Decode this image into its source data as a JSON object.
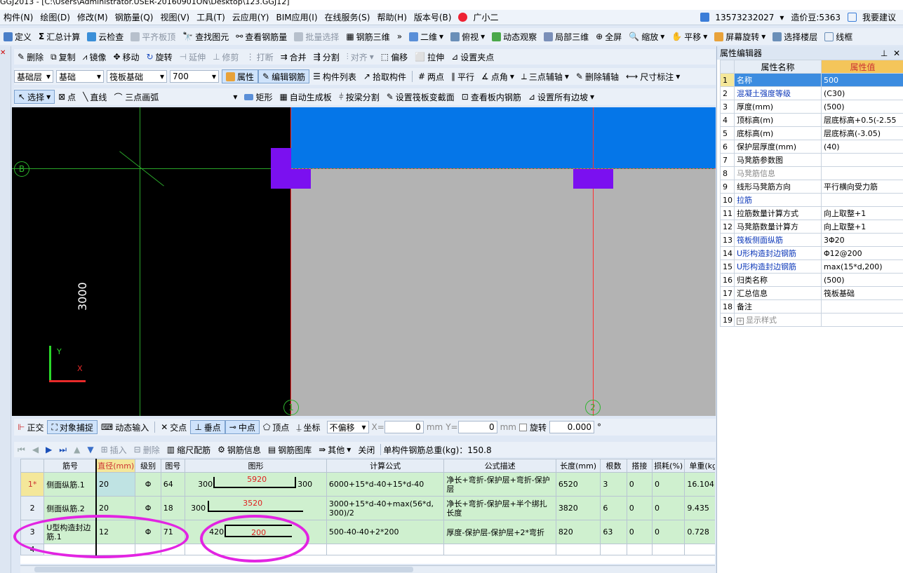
{
  "title_bar": {
    "title": "GGJ2013 - [C:\\Users\\Administrator.USER-20160901ON\\Desktop\\123.GGJ12]"
  },
  "menu": {
    "items": [
      "构件(N)",
      "绘图(D)",
      "修改(M)",
      "钢筋量(Q)",
      "视图(V)",
      "工具(T)",
      "云应用(Y)",
      "BIM应用(I)",
      "在线服务(S)",
      "帮助(H)",
      "版本号(B)"
    ],
    "assistant": "广小二",
    "phone": "13573232027",
    "beans": "造价豆:5363",
    "suggest": "我要建议"
  },
  "toolbar1": {
    "items": [
      "定义",
      "汇总计算",
      "云检查",
      "平齐板顶",
      "查找图元",
      "查看钢筋量",
      "批量选择",
      "钢筋三维",
      "二维",
      "俯视",
      "动态观察",
      "局部三维",
      "全屏",
      "缩放",
      "平移",
      "屏幕旋转",
      "选择楼层",
      "线框"
    ]
  },
  "toolbar2": {
    "items": [
      "删除",
      "复制",
      "镜像",
      "移动",
      "旋转",
      "延伸",
      "修剪",
      "打断",
      "合并",
      "分割",
      "对齐",
      "偏移",
      "拉伸",
      "设置夹点"
    ]
  },
  "toolbar3": {
    "floor": "基础层",
    "category": "基础",
    "type": "筏板基础",
    "value": "700",
    "items": [
      "属性",
      "编辑钢筋",
      "构件列表",
      "拾取构件",
      "两点",
      "平行",
      "点角",
      "三点辅轴",
      "删除辅轴",
      "尺寸标注"
    ]
  },
  "toolbar4": {
    "items": [
      "选择",
      "点",
      "直线",
      "三点画弧",
      "矩形",
      "自动生成板",
      "按梁分割",
      "设置筏板变截面",
      "查看板内钢筋",
      "设置所有边坡"
    ]
  },
  "canvas": {
    "dimension": "3000",
    "axis_b": "B",
    "axis_1": "1",
    "axis_2": "2",
    "y_label": "Y",
    "x_label": "X"
  },
  "statusbar": {
    "items": [
      "正交",
      "对象捕捉",
      "动态输入",
      "交点",
      "垂点",
      "中点",
      "顶点",
      "坐标"
    ],
    "offset": "不偏移",
    "x_label": "X=",
    "x_value": "0",
    "y_label": "Y=",
    "y_value": "0",
    "unit": "mm",
    "rotate": "旋转",
    "rotate_value": "0.000",
    "deg": "°"
  },
  "rebar_toolbar": {
    "items": [
      "插入",
      "删除",
      "缩尺配筋",
      "钢筋信息",
      "钢筋图库",
      "其他",
      "关闭"
    ],
    "total": "单构件钢筋总重(kg)：150.8"
  },
  "rebar_table": {
    "headers": [
      "筋号",
      "直径(mm)",
      "级别",
      "图号",
      "图形",
      "计算公式",
      "公式描述",
      "长度(mm)",
      "根数",
      "搭接",
      "损耗(%)",
      "单重(kg"
    ],
    "rows": [
      {
        "num": "1*",
        "name": "侧面纵筋.1",
        "dia": "20",
        "grade": "Φ",
        "fig": "64",
        "shape_left": "300",
        "shape_mid": "5920",
        "shape_right": "300",
        "formula": "6000+15*d-40+15*d-40",
        "desc": "净长+弯折-保护层+弯折-保护层",
        "len": "6520",
        "count": "3",
        "lap": "0",
        "loss": "0",
        "weight": "16.104"
      },
      {
        "num": "2",
        "name": "侧面纵筋.2",
        "dia": "20",
        "grade": "Φ",
        "fig": "18",
        "shape_left": "300",
        "shape_mid": "3520",
        "shape_right": "",
        "formula": "3000+15*d-40+max(56*d, 300)/2",
        "desc": "净长+弯折-保护层+半个绑扎长度",
        "len": "3820",
        "count": "6",
        "lap": "0",
        "loss": "0",
        "weight": "9.435"
      },
      {
        "num": "3",
        "name": "U型构造封边筋.1",
        "dia": "12",
        "grade": "Φ",
        "fig": "71",
        "shape_left": "420",
        "shape_mid": "200",
        "shape_right": "",
        "formula": "500-40-40+2*200",
        "desc": "厚度-保护层-保护层+2*弯折",
        "len": "820",
        "count": "63",
        "lap": "0",
        "loss": "0",
        "weight": "0.728"
      },
      {
        "num": "4",
        "name": "",
        "dia": "",
        "grade": "",
        "fig": "",
        "shape_left": "",
        "shape_mid": "",
        "shape_right": "",
        "formula": "",
        "desc": "",
        "len": "",
        "count": "",
        "lap": "",
        "loss": "",
        "weight": ""
      }
    ]
  },
  "props": {
    "panel_title": "属性编辑器",
    "col_name": "属性名称",
    "col_value": "属性值",
    "rows": [
      {
        "n": "1",
        "name": "名称",
        "value": "500",
        "blue": true
      },
      {
        "n": "2",
        "name": "混凝土强度等级",
        "value": "(C30)",
        "blue": true
      },
      {
        "n": "3",
        "name": "厚度(mm)",
        "value": "(500)",
        "blue": false
      },
      {
        "n": "4",
        "name": "顶标高(m)",
        "value": "层底标高+0.5(-2.55",
        "blue": false
      },
      {
        "n": "5",
        "name": "底标高(m)",
        "value": "层底标高(-3.05)",
        "blue": false
      },
      {
        "n": "6",
        "name": "保护层厚度(mm)",
        "value": "(40)",
        "blue": false
      },
      {
        "n": "7",
        "name": "马凳筋参数图",
        "value": "",
        "blue": false
      },
      {
        "n": "8",
        "name": "马凳筋信息",
        "value": "",
        "blue": false
      },
      {
        "n": "9",
        "name": "线形马凳筋方向",
        "value": "平行横向受力筋",
        "blue": false
      },
      {
        "n": "10",
        "name": "拉筋",
        "value": "",
        "blue": true
      },
      {
        "n": "11",
        "name": "拉筋数量计算方式",
        "value": "向上取整+1",
        "blue": false
      },
      {
        "n": "12",
        "name": "马凳筋数量计算方",
        "value": "向上取整+1",
        "blue": false
      },
      {
        "n": "13",
        "name": "筏板侧面纵筋",
        "value": "3Φ20",
        "blue": true
      },
      {
        "n": "14",
        "name": "U形构造封边钢筋",
        "value": "Φ12@200",
        "blue": true
      },
      {
        "n": "15",
        "name": "U形构造封边钢筋",
        "value": "max(15*d,200)",
        "blue": true
      },
      {
        "n": "16",
        "name": "归类名称",
        "value": "(500)",
        "blue": false
      },
      {
        "n": "17",
        "name": "汇总信息",
        "value": "筏板基础",
        "blue": false
      },
      {
        "n": "18",
        "name": "备注",
        "value": "",
        "blue": false
      },
      {
        "n": "19",
        "name": "显示样式",
        "value": "",
        "blue": false
      }
    ]
  }
}
